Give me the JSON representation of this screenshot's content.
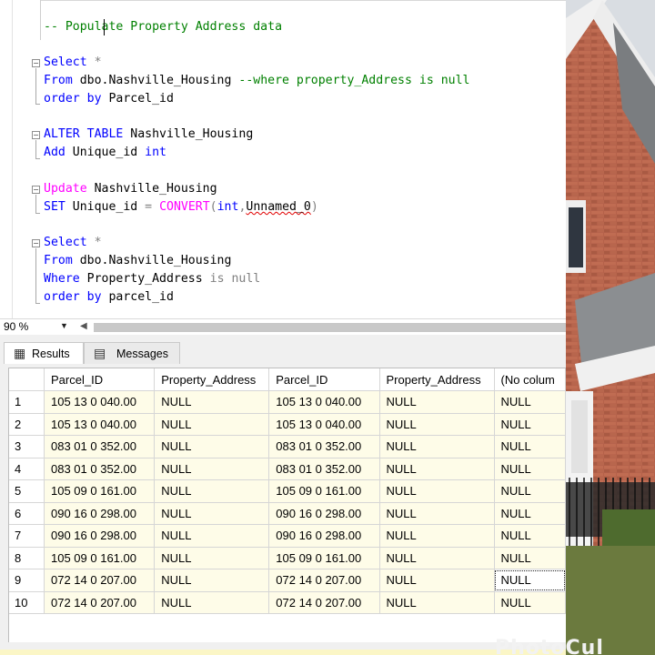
{
  "editor": {
    "lines": [
      [
        {
          "t": "-- Populate Property Address data",
          "c": "cmt"
        }
      ],
      [
        {
          "t": "Select",
          "c": "kw"
        },
        {
          "t": " ",
          "c": ""
        },
        {
          "t": "*",
          "c": "gry"
        }
      ],
      [
        {
          "t": "From",
          "c": "kw"
        },
        {
          "t": " dbo.Nashville_Housing ",
          "c": ""
        },
        {
          "t": "--where property_Address is null",
          "c": "cmt"
        }
      ],
      [
        {
          "t": "order by",
          "c": "kw"
        },
        {
          "t": " Parcel_id",
          "c": ""
        }
      ],
      [
        {
          "t": "ALTER TABLE",
          "c": "kw"
        },
        {
          "t": " Nashville_Housing",
          "c": ""
        }
      ],
      [
        {
          "t": "Add",
          "c": "kw"
        },
        {
          "t": " Unique_id ",
          "c": ""
        },
        {
          "t": "int",
          "c": "kw"
        }
      ],
      [
        {
          "t": "Update",
          "c": "fn"
        },
        {
          "t": " Nashville_Housing",
          "c": ""
        }
      ],
      [
        {
          "t": "SET",
          "c": "kw"
        },
        {
          "t": " Unique_id ",
          "c": ""
        },
        {
          "t": "=",
          "c": "gry"
        },
        {
          "t": " ",
          "c": ""
        },
        {
          "t": "CONVERT",
          "c": "fn"
        },
        {
          "t": "(",
          "c": "gry"
        },
        {
          "t": "int",
          "c": "kw"
        },
        {
          "t": ",",
          "c": "gry"
        },
        {
          "t": "Unnamed_0",
          "c": "squig"
        },
        {
          "t": ")",
          "c": "gry"
        }
      ],
      [
        {
          "t": "Select",
          "c": "kw"
        },
        {
          "t": " ",
          "c": ""
        },
        {
          "t": "*",
          "c": "gry"
        }
      ],
      [
        {
          "t": "From",
          "c": "kw"
        },
        {
          "t": " dbo.Nashville_Housing",
          "c": ""
        }
      ],
      [
        {
          "t": "Where",
          "c": "kw"
        },
        {
          "t": " Property_Address ",
          "c": ""
        },
        {
          "t": "is null",
          "c": "gry"
        }
      ],
      [
        {
          "t": "order by",
          "c": "kw"
        },
        {
          "t": " parcel_id",
          "c": ""
        }
      ]
    ]
  },
  "zoom": {
    "value": "90 %"
  },
  "tabs": {
    "results": "Results",
    "messages": "Messages"
  },
  "grid": {
    "columns": [
      "Parcel_ID",
      "Property_Address",
      "Parcel_ID",
      "Property_Address",
      "(No colum"
    ],
    "rows": [
      [
        "1",
        "105 13 0 040.00",
        "NULL",
        "105 13 0 040.00",
        "NULL",
        "NULL"
      ],
      [
        "2",
        "105 13 0 040.00",
        "NULL",
        "105 13 0 040.00",
        "NULL",
        "NULL"
      ],
      [
        "3",
        "083 01 0 352.00",
        "NULL",
        "083 01 0 352.00",
        "NULL",
        "NULL"
      ],
      [
        "4",
        "083 01 0 352.00",
        "NULL",
        "083 01 0 352.00",
        "NULL",
        "NULL"
      ],
      [
        "5",
        "105 09 0 161.00",
        "NULL",
        "105 09 0 161.00",
        "NULL",
        "NULL"
      ],
      [
        "6",
        "090 16 0 298.00",
        "NULL",
        "090 16 0 298.00",
        "NULL",
        "NULL"
      ],
      [
        "7",
        "090 16 0 298.00",
        "NULL",
        "090 16 0 298.00",
        "NULL",
        "NULL"
      ],
      [
        "8",
        "105 09 0 161.00",
        "NULL",
        "105 09 0 161.00",
        "NULL",
        "NULL"
      ],
      [
        "9",
        "072 14 0 207.00",
        "NULL",
        "072 14 0 207.00",
        "NULL",
        "NULL"
      ],
      [
        "10",
        "072 14 0 207.00",
        "NULL",
        "072 14 0 207.00",
        "NULL",
        "NULL"
      ]
    ],
    "selected_row": 8,
    "selected_col": 5
  },
  "photo": {
    "watermark": "PhotoCul"
  }
}
